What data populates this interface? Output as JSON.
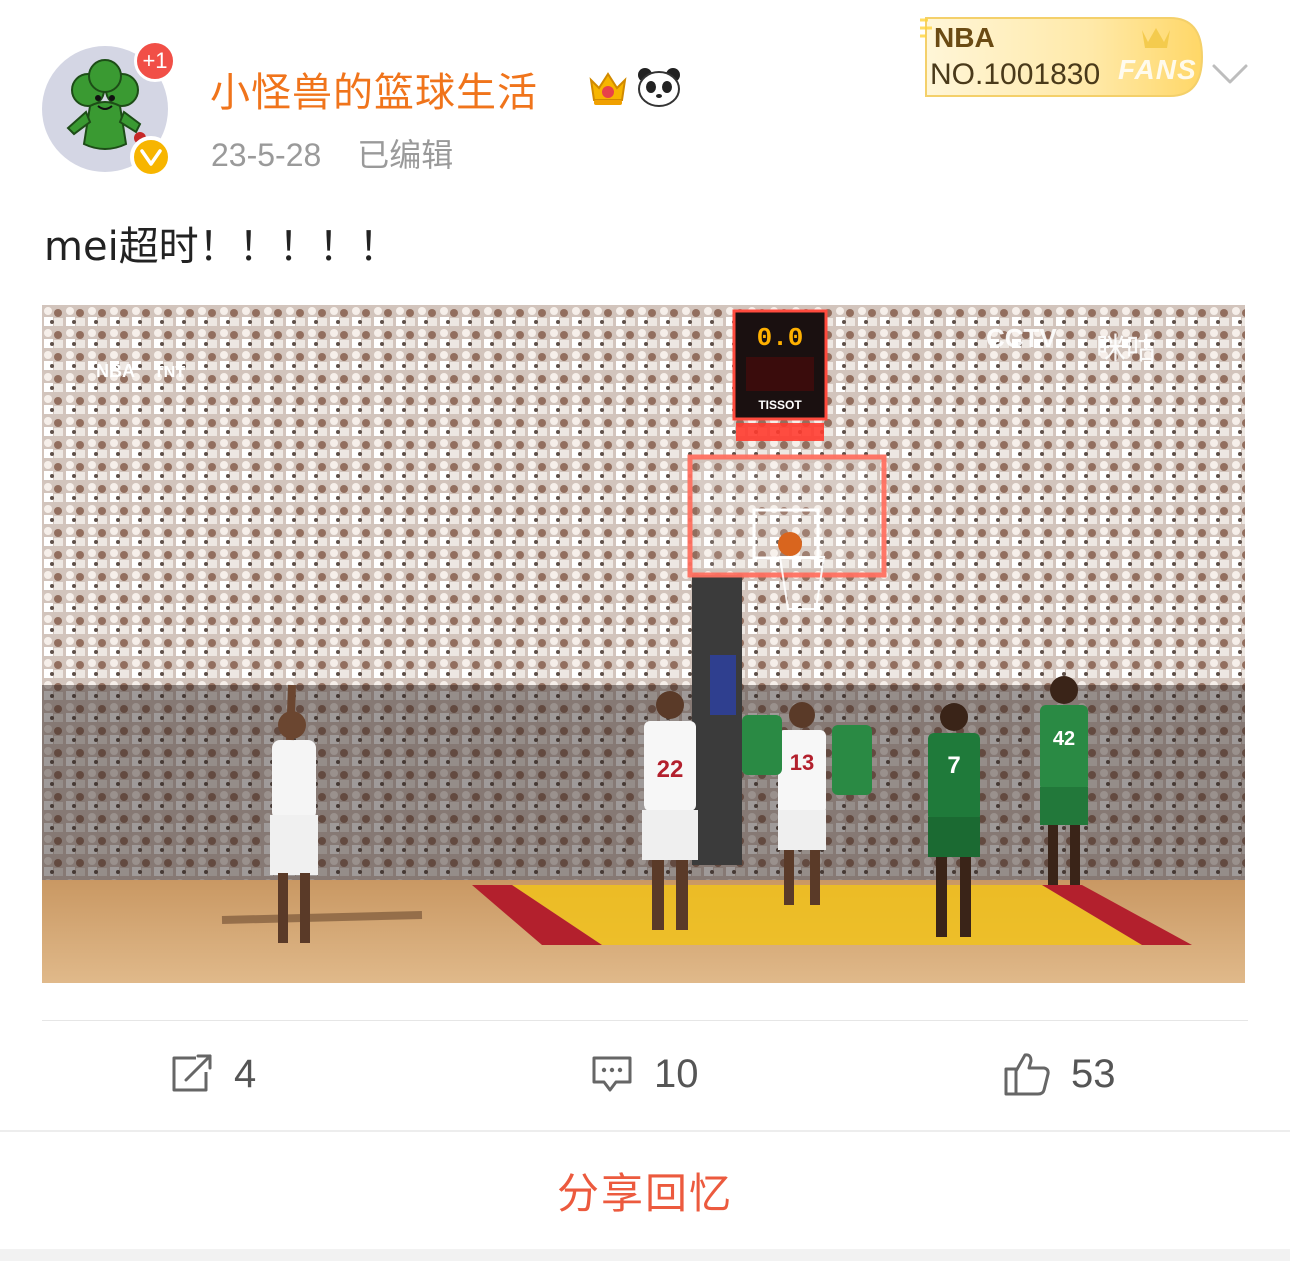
{
  "header": {
    "username": "小怪兽的篮球生活",
    "notification_badge": "+1",
    "date": "23-5-28",
    "edited_label": "已编辑",
    "icons": [
      "crown-icon",
      "panda-icon",
      "verified-icon",
      "chevron-down-icon"
    ]
  },
  "fans_card": {
    "title": "NBA",
    "number": "NO.1001830",
    "word": "FANS"
  },
  "post": {
    "text": "mei超时！！！！！"
  },
  "video": {
    "scoreboard": "0.0",
    "sponsor": "TISSOT",
    "broadcaster_left": "NBA",
    "broadcaster_tnt": "TNT",
    "broadcaster_right": "CCTV",
    "broadcaster_migu": "咪咕",
    "jersey_numbers": [
      "22",
      "13",
      "7",
      "42"
    ]
  },
  "actions": {
    "repost_count": "4",
    "comment_count": "10",
    "like_count": "53"
  },
  "footer": {
    "share_memory": "分享回忆"
  },
  "colors": {
    "username": "#f0741b",
    "share": "#ec5a3e",
    "badge": "#f14f47",
    "verified": "#f7b500"
  }
}
